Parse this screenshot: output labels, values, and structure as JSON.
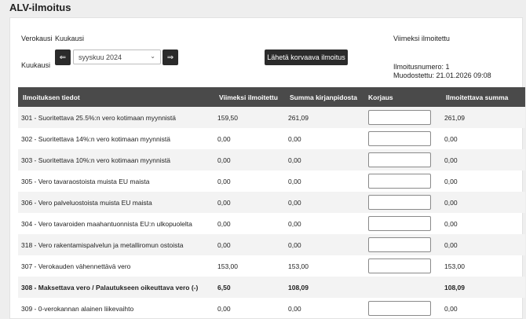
{
  "page": {
    "title": "ALV-ilmoitus"
  },
  "form": {
    "verokausi_label": "Verokausi",
    "verokausi_value": "Kuukausi",
    "kuukausi_label": "Kuukausi",
    "prev_label": "⇐",
    "next_label": "⇒",
    "month_value": "syyskuu 2024",
    "submit_label": "Lähetä korvaava ilmoitus"
  },
  "info": {
    "heading": "Viimeksi ilmoitettu",
    "number_line": "Ilmoitusnumero: 1",
    "created_line": "Muodostettu: 21.01.2026 09:08"
  },
  "table": {
    "headers": [
      "Ilmoituksen tiedot",
      "Viimeksi ilmoitettu",
      "Summa kirjanpidosta",
      "Korjaus",
      "Ilmoitettava summa"
    ],
    "rows": [
      {
        "label": "301 - Suoritettava 25.5%:n vero kotimaan myynnistä",
        "last": "159,50",
        "books": "261,09",
        "input": true,
        "amount": "261,09",
        "bold": false
      },
      {
        "label": "302 - Suoritettava 14%:n vero kotimaan myynnistä",
        "last": "0,00",
        "books": "0,00",
        "input": true,
        "amount": "0,00",
        "bold": false
      },
      {
        "label": "303 - Suoritettava 10%:n vero kotimaan myynnistä",
        "last": "0,00",
        "books": "0,00",
        "input": true,
        "amount": "0,00",
        "bold": false
      },
      {
        "label": "305 - Vero tavaraostoista muista EU maista",
        "last": "0,00",
        "books": "0,00",
        "input": true,
        "amount": "0,00",
        "bold": false
      },
      {
        "label": "306 - Vero palveluostoista muista EU maista",
        "last": "0,00",
        "books": "0,00",
        "input": true,
        "amount": "0,00",
        "bold": false
      },
      {
        "label": "304 - Vero tavaroiden maahantuonnista EU:n ulkopuolelta",
        "last": "0,00",
        "books": "0,00",
        "input": true,
        "amount": "0,00",
        "bold": false
      },
      {
        "label": "318 - Vero rakentamispalvelun ja metalliromun ostoista",
        "last": "0,00",
        "books": "0,00",
        "input": true,
        "amount": "0,00",
        "bold": false
      },
      {
        "label": "307 - Verokauden vähennettävä vero",
        "last": "153,00",
        "books": "153,00",
        "input": true,
        "amount": "153,00",
        "bold": false
      },
      {
        "label": "308 - Maksettava vero / Palautukseen oikeuttava vero (-)",
        "last": "6,50",
        "books": "108,09",
        "input": false,
        "amount": "108,09",
        "bold": true
      },
      {
        "label": "309 - 0-verokannan alainen liikevaihto",
        "last": "0,00",
        "books": "0,00",
        "input": true,
        "amount": "0,00",
        "bold": false
      }
    ]
  }
}
